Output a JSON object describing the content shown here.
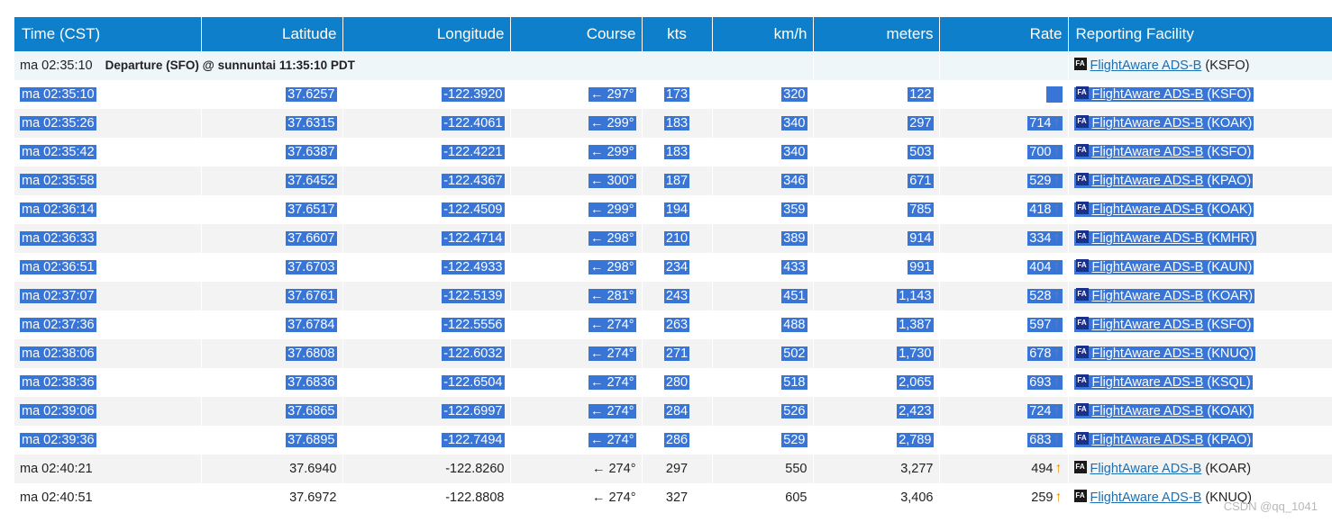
{
  "columns": {
    "time": "Time (CST)",
    "latitude": "Latitude",
    "longitude": "Longitude",
    "course": "Course",
    "kts": "kts",
    "kmh": "km/h",
    "meters": "meters",
    "rate": "Rate",
    "facility": "Reporting Facility"
  },
  "departure": {
    "time": "ma 02:35:10",
    "label": "Departure (SFO) @ sunnuntai 11:35:10 PDT",
    "facility_badge": "FA",
    "facility_link": "FlightAware ADS-B",
    "facility_code": "(KSFO)"
  },
  "rows": [
    {
      "time": "ma 02:35:10",
      "lat": "37.6257",
      "lon": "-122.3920",
      "course": "← 297°",
      "kts": "173",
      "kmh": "320",
      "meters": "122",
      "rate": "",
      "arrow": "",
      "badge": "FA",
      "link": "FlightAware ADS-B",
      "code": "(KSFO)",
      "selected": true
    },
    {
      "time": "ma 02:35:26",
      "lat": "37.6315",
      "lon": "-122.4061",
      "course": "← 299°",
      "kts": "183",
      "kmh": "340",
      "meters": "297",
      "rate": "714",
      "arrow": "↑",
      "badge": "FA",
      "link": "FlightAware ADS-B",
      "code": "(KOAK)",
      "selected": true
    },
    {
      "time": "ma 02:35:42",
      "lat": "37.6387",
      "lon": "-122.4221",
      "course": "← 299°",
      "kts": "183",
      "kmh": "340",
      "meters": "503",
      "rate": "700",
      "arrow": "↑",
      "badge": "FA",
      "link": "FlightAware ADS-B",
      "code": "(KSFO)",
      "selected": true
    },
    {
      "time": "ma 02:35:58",
      "lat": "37.6452",
      "lon": "-122.4367",
      "course": "← 300°",
      "kts": "187",
      "kmh": "346",
      "meters": "671",
      "rate": "529",
      "arrow": "↑",
      "badge": "FA",
      "link": "FlightAware ADS-B",
      "code": "(KPAO)",
      "selected": true
    },
    {
      "time": "ma 02:36:14",
      "lat": "37.6517",
      "lon": "-122.4509",
      "course": "← 299°",
      "kts": "194",
      "kmh": "359",
      "meters": "785",
      "rate": "418",
      "arrow": "↑",
      "badge": "FA",
      "link": "FlightAware ADS-B",
      "code": "(KOAK)",
      "selected": true
    },
    {
      "time": "ma 02:36:33",
      "lat": "37.6607",
      "lon": "-122.4714",
      "course": "← 298°",
      "kts": "210",
      "kmh": "389",
      "meters": "914",
      "rate": "334",
      "arrow": "↑",
      "badge": "FA",
      "link": "FlightAware ADS-B",
      "code": "(KMHR)",
      "selected": true
    },
    {
      "time": "ma 02:36:51",
      "lat": "37.6703",
      "lon": "-122.4933",
      "course": "← 298°",
      "kts": "234",
      "kmh": "433",
      "meters": "991",
      "rate": "404",
      "arrow": "↑",
      "badge": "FA",
      "link": "FlightAware ADS-B",
      "code": "(KAUN)",
      "selected": true
    },
    {
      "time": "ma 02:37:07",
      "lat": "37.6761",
      "lon": "-122.5139",
      "course": "← 281°",
      "kts": "243",
      "kmh": "451",
      "meters": "1,143",
      "rate": "528",
      "arrow": "↑",
      "badge": "FA",
      "link": "FlightAware ADS-B",
      "code": "(KOAR)",
      "selected": true
    },
    {
      "time": "ma 02:37:36",
      "lat": "37.6784",
      "lon": "-122.5556",
      "course": "← 274°",
      "kts": "263",
      "kmh": "488",
      "meters": "1,387",
      "rate": "597",
      "arrow": "↑",
      "badge": "FA",
      "link": "FlightAware ADS-B",
      "code": "(KSFO)",
      "selected": true
    },
    {
      "time": "ma 02:38:06",
      "lat": "37.6808",
      "lon": "-122.6032",
      "course": "← 274°",
      "kts": "271",
      "kmh": "502",
      "meters": "1,730",
      "rate": "678",
      "arrow": "↑",
      "badge": "FA",
      "link": "FlightAware ADS-B",
      "code": "(KNUQ)",
      "selected": true
    },
    {
      "time": "ma 02:38:36",
      "lat": "37.6836",
      "lon": "-122.6504",
      "course": "← 274°",
      "kts": "280",
      "kmh": "518",
      "meters": "2,065",
      "rate": "693",
      "arrow": "↑",
      "badge": "FA",
      "link": "FlightAware ADS-B",
      "code": "(KSQL)",
      "selected": true
    },
    {
      "time": "ma 02:39:06",
      "lat": "37.6865",
      "lon": "-122.6997",
      "course": "← 274°",
      "kts": "284",
      "kmh": "526",
      "meters": "2,423",
      "rate": "724",
      "arrow": "↑",
      "badge": "FA",
      "link": "FlightAware ADS-B",
      "code": "(KOAK)",
      "selected": true
    },
    {
      "time": "ma 02:39:36",
      "lat": "37.6895",
      "lon": "-122.7494",
      "course": "← 274°",
      "kts": "286",
      "kmh": "529",
      "meters": "2,789",
      "rate": "683",
      "arrow": "↑",
      "badge": "FA",
      "link": "FlightAware ADS-B",
      "code": "(KPAO)",
      "selected": true
    },
    {
      "time": "ma 02:40:21",
      "lat": "37.6940",
      "lon": "-122.8260",
      "course": "← 274°",
      "kts": "297",
      "kmh": "550",
      "meters": "3,277",
      "rate": "494",
      "arrow": "↑",
      "badge": "FA",
      "link": "FlightAware ADS-B",
      "code": "(KOAR)",
      "selected": false
    },
    {
      "time": "ma 02:40:51",
      "lat": "37.6972",
      "lon": "-122.8808",
      "course": "← 274°",
      "kts": "327",
      "kmh": "605",
      "meters": "3,406",
      "rate": "259",
      "arrow": "↑",
      "badge": "FA",
      "link": "FlightAware ADS-B",
      "code": "(KNUQ)",
      "selected": false
    }
  ],
  "watermark": "CSDN @qq_1041",
  "colors": {
    "header_bg": "#0d7fcb",
    "selection": "#3875d7",
    "link": "#1a6fb5",
    "climb_arrow": "#f08c00"
  }
}
